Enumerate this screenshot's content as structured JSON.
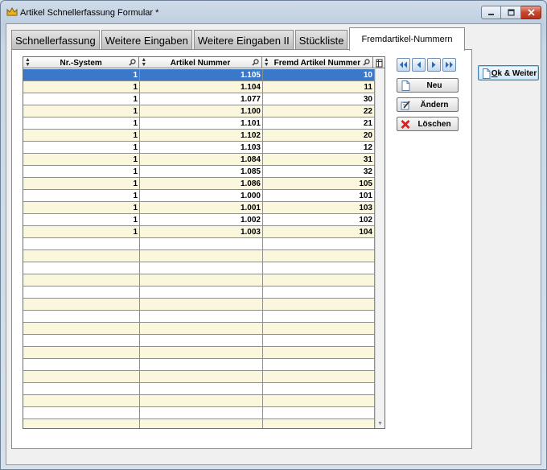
{
  "window": {
    "title": "Artikel Schnellerfassung Formular *"
  },
  "tabs": [
    {
      "label": "Schnellerfassung",
      "active": false
    },
    {
      "label": "Weitere Eingaben",
      "active": false
    },
    {
      "label": "Weitere Eingaben II",
      "active": false
    },
    {
      "label": "Stückliste",
      "active": false
    },
    {
      "label": "Fremdartikel-Nummern",
      "active": true
    }
  ],
  "grid": {
    "columns": [
      "Nr.-System",
      "Artikel Nummer",
      "Fremd Artikel Nummer"
    ],
    "rows": [
      [
        "1",
        "1.105",
        "10"
      ],
      [
        "1",
        "1.104",
        "11"
      ],
      [
        "1",
        "1.077",
        "30"
      ],
      [
        "1",
        "1.100",
        "22"
      ],
      [
        "1",
        "1.101",
        "21"
      ],
      [
        "1",
        "1.102",
        "20"
      ],
      [
        "1",
        "1.103",
        "12"
      ],
      [
        "1",
        "1.084",
        "31"
      ],
      [
        "1",
        "1.085",
        "32"
      ],
      [
        "1",
        "1.086",
        "105"
      ],
      [
        "1",
        "1.000",
        "101"
      ],
      [
        "1",
        "1.001",
        "103"
      ],
      [
        "1",
        "1.002",
        "102"
      ],
      [
        "1",
        "1.003",
        "104"
      ]
    ],
    "selected_row": 0,
    "empty_rows": 16
  },
  "actions": {
    "new_label": "Neu",
    "edit_label": "Ändern",
    "delete_label": "Löschen",
    "ok_label": "Ok & Weiter"
  },
  "colors": {
    "selection": "#3a79c9",
    "row_alt": "#fbf7dc",
    "delete_red": "#d42020"
  }
}
